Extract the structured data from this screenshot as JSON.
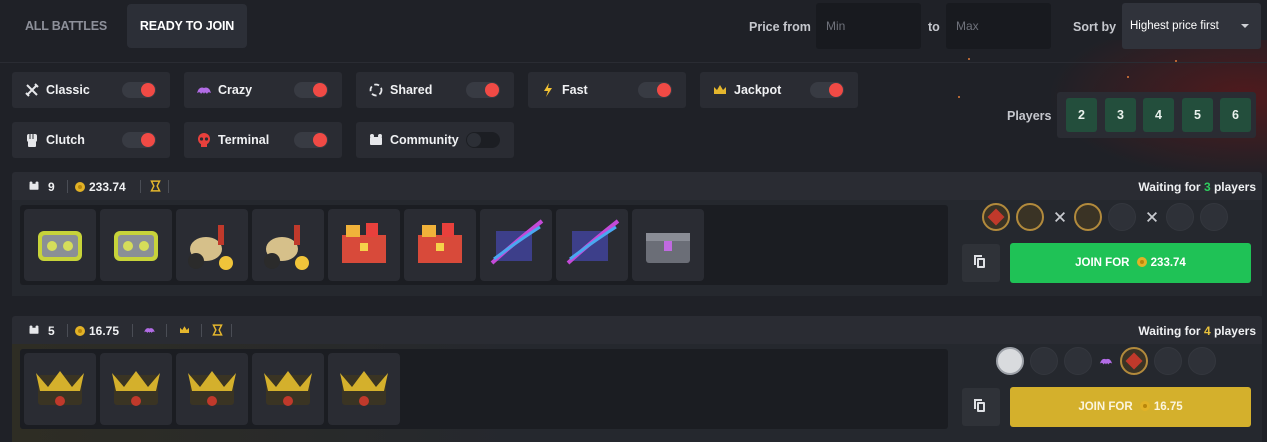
{
  "tabs": {
    "all_battles": "ALL BATTLES",
    "ready_to_join": "READY TO JOIN"
  },
  "filters": {
    "price_from_label": "Price from",
    "min_placeholder": "Min",
    "to_label": "to",
    "max_placeholder": "Max",
    "sort_label": "Sort by",
    "sort_value": "Highest price first"
  },
  "modes": [
    {
      "label": "Classic",
      "icon": "crossed-swords-icon",
      "enabled": true
    },
    {
      "label": "Crazy",
      "icon": "crazy-icon",
      "enabled": true
    },
    {
      "label": "Shared",
      "icon": "shared-icon",
      "enabled": true
    },
    {
      "label": "Fast",
      "icon": "lightning-icon",
      "enabled": true
    },
    {
      "label": "Jackpot",
      "icon": "crown-icon",
      "enabled": true
    },
    {
      "label": "Clutch",
      "icon": "fist-icon",
      "enabled": true
    },
    {
      "label": "Terminal",
      "icon": "skull-icon",
      "enabled": true
    },
    {
      "label": "Community",
      "icon": "community-icon",
      "enabled": false
    }
  ],
  "players": {
    "label": "Players",
    "options": [
      "2",
      "3",
      "4",
      "5",
      "6"
    ]
  },
  "battles": [
    {
      "case_count": "9",
      "price": "233.74",
      "waiting_prefix": "Waiting for ",
      "waiting_count": "3",
      "waiting_suffix": " players",
      "join_label": "JOIN FOR",
      "join_amount": "233.74",
      "accent": "#1fc256",
      "modes": [
        "trophy-icon"
      ]
    },
    {
      "case_count": "5",
      "price": "16.75",
      "waiting_prefix": "Waiting for ",
      "waiting_count": "4",
      "waiting_suffix": " players",
      "join_label": "JOIN FOR",
      "join_amount": "16.75",
      "accent": "#d4b02c",
      "modes": [
        "crazy-icon",
        "crown-icon",
        "trophy-icon"
      ]
    }
  ]
}
